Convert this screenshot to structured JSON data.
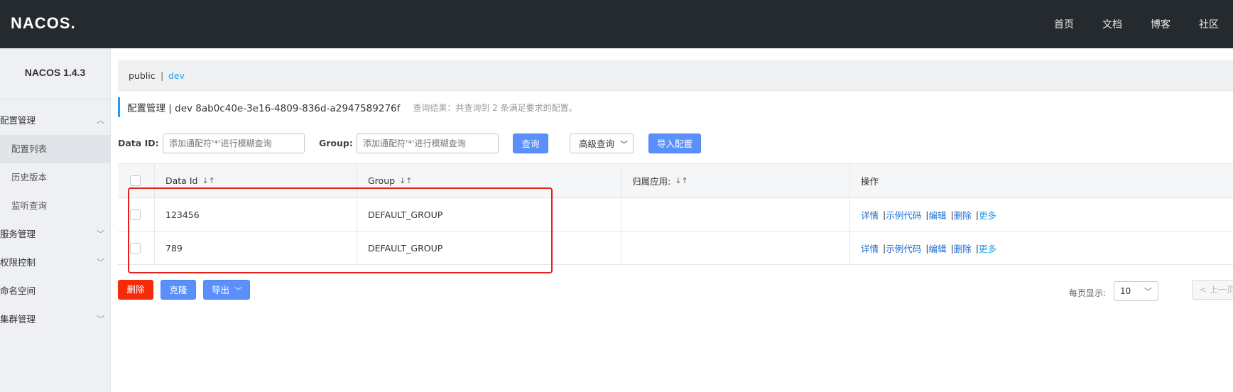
{
  "header": {
    "logo": "NACOS.",
    "nav": [
      "首页",
      "文档",
      "博客",
      "社区"
    ]
  },
  "sidebar": {
    "title": "NACOS 1.4.3",
    "items": [
      {
        "label": "配置管理",
        "chevron": "︿"
      },
      {
        "label": "配置列表"
      },
      {
        "label": "历史版本"
      },
      {
        "label": "监听查询"
      },
      {
        "label": "服务管理",
        "chevron": "﹀"
      },
      {
        "label": "权限控制",
        "chevron": "﹀"
      },
      {
        "label": "命名空间"
      },
      {
        "label": "集群管理",
        "chevron": "﹀"
      }
    ]
  },
  "namespace": {
    "items": [
      "public",
      "dev"
    ],
    "separator": "|",
    "active": "dev"
  },
  "title": {
    "main": "配置管理 | dev  8ab0c40e-3e16-4809-836d-a2947589276f",
    "hint": "查询结果：共查询到 2 条满足要求的配置。"
  },
  "search": {
    "dataid_label": "Data ID:",
    "dataid_placeholder": "添加通配符'*'进行模糊查询",
    "group_label": "Group:",
    "group_placeholder": "添加通配符'*'进行模糊查询",
    "query_btn": "查询",
    "advanced_btn": "高级查询",
    "import_btn": "导入配置"
  },
  "table": {
    "headers": [
      "Data Id",
      "Group",
      "归属应用:",
      "操作"
    ],
    "sort_icon": "↓↑",
    "rows": [
      {
        "dataid": "123456",
        "group": "DEFAULT_GROUP",
        "app": ""
      },
      {
        "dataid": "789",
        "group": "DEFAULT_GROUP",
        "app": ""
      }
    ],
    "ops": [
      "详情",
      "示例代码",
      "编辑",
      "删除"
    ],
    "ops_more": "更多",
    "ops_sep": "|"
  },
  "footer": {
    "delete_btn": "删除",
    "clone_btn": "克隆",
    "export_btn": "导出",
    "page_size_label": "每页显示:",
    "page_size": "10",
    "prev_btn": "< 上一页"
  },
  "colors": {
    "topbar": "#252a2f",
    "primary": "#5b8ff9",
    "danger": "#f52a0a",
    "highlight": "#e3201a",
    "link": "#1b6ed0"
  }
}
